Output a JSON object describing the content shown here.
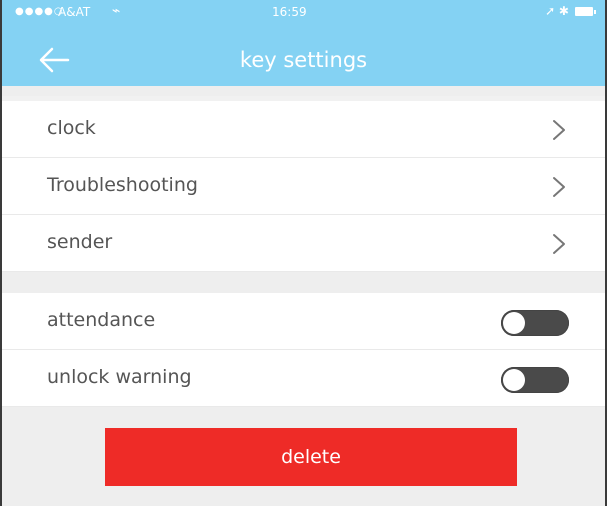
{
  "status_bar": {
    "signal": "●●●●○",
    "carrier": "A&AT",
    "wifi_icon": "wifi-icon",
    "time": "16:59",
    "right_icons": "➚ ✱",
    "battery_icon": "battery-icon"
  },
  "header": {
    "title": "key settings",
    "back_icon": "arrow-left-icon"
  },
  "menu_items": [
    {
      "label": "clock",
      "icon": "chevron-right-icon"
    },
    {
      "label": "Troubleshooting",
      "icon": "chevron-right-icon"
    },
    {
      "label": "sender",
      "icon": "chevron-right-icon"
    }
  ],
  "toggles": [
    {
      "label": "attendance",
      "state": "off"
    },
    {
      "label": "unlock warning",
      "state": "off"
    }
  ],
  "actions": {
    "delete_label": "delete"
  },
  "colors": {
    "header": "#84d2f3",
    "delete": "#ee2b27",
    "toggle_off": "#4a4a4a",
    "background": "#eeeeee"
  }
}
